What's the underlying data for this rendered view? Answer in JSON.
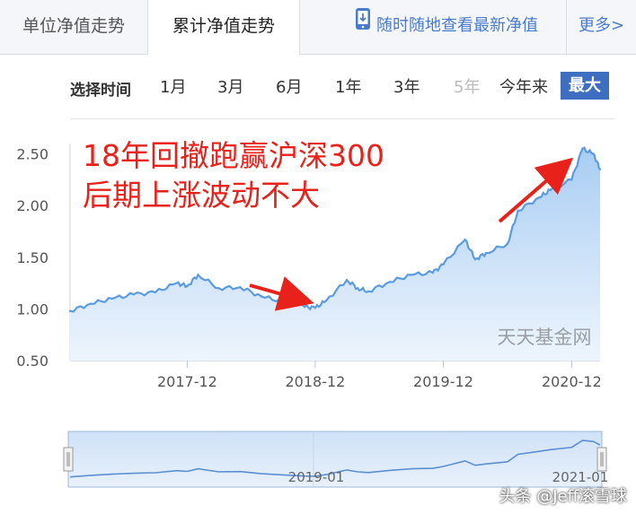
{
  "tabs": {
    "unit_nav": "单位净值走势",
    "cumulative_nav": "累计净值走势",
    "mobile_link": "随时随地查看最新净值",
    "more": "更多>"
  },
  "time_selector": {
    "label": "选择时间",
    "options": [
      "1月",
      "3月",
      "6月",
      "1年",
      "3年",
      "5年",
      "今年来",
      "最大"
    ],
    "disabled": "5年",
    "selected": "最大"
  },
  "annotation": {
    "line1": "18年回撤跑赢沪深300",
    "line2": "后期上涨波动不大",
    "color": "#e8221b"
  },
  "chart_watermark": "天天基金网",
  "image_watermark": "头条 @Jeff滚雪球",
  "colors": {
    "accent": "#3d6ebf",
    "line": "#5b9be0",
    "area_top": "#a9cdf3",
    "area_bottom": "#eef5fd",
    "arrow": "#e8221b"
  },
  "chart_data": {
    "type": "area",
    "title": "",
    "xlabel": "",
    "ylabel": "",
    "ylim": [
      0.5,
      2.6
    ],
    "y_ticks": [
      "2.50",
      "2.00",
      "1.50",
      "1.00",
      "0.50"
    ],
    "x_ticks": [
      "2017-12",
      "2018-12",
      "2019-12",
      "2020-12"
    ],
    "x": [
      "2017-01",
      "2017-03",
      "2017-05",
      "2017-07",
      "2017-09",
      "2017-11",
      "2017-12",
      "2018-01",
      "2018-03",
      "2018-05",
      "2018-07",
      "2018-09",
      "2018-11",
      "2018-12",
      "2019-01",
      "2019-03",
      "2019-04",
      "2019-05",
      "2019-07",
      "2019-09",
      "2019-11",
      "2019-12",
      "2020-02",
      "2020-03",
      "2020-04",
      "2020-06",
      "2020-07",
      "2020-09",
      "2020-10",
      "2020-12",
      "2021-01",
      "2021-02",
      "2021-02-20"
    ],
    "series": [
      {
        "values": [
          0.98,
          1.05,
          1.1,
          1.14,
          1.16,
          1.25,
          1.22,
          1.33,
          1.2,
          1.21,
          1.12,
          1.07,
          1.02,
          1.01,
          1.08,
          1.28,
          1.2,
          1.17,
          1.26,
          1.33,
          1.35,
          1.43,
          1.67,
          1.48,
          1.54,
          1.63,
          1.95,
          2.08,
          2.15,
          2.25,
          2.55,
          2.5,
          2.35
        ]
      }
    ],
    "navigator": {
      "start_label": "2019-01",
      "end_label": "2021-01"
    },
    "grid": false,
    "legend": "none"
  }
}
